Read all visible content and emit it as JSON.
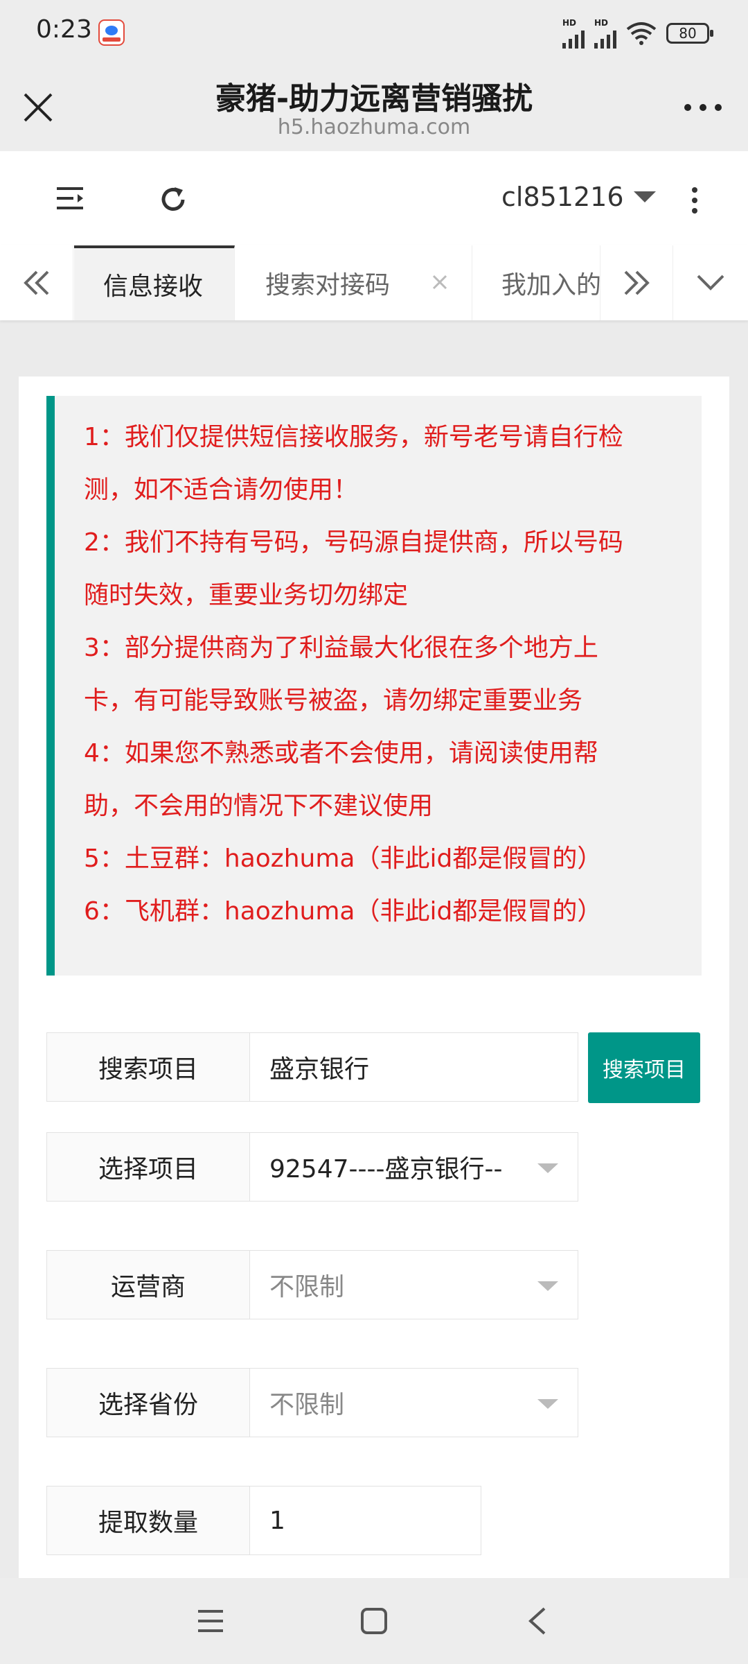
{
  "status_bar": {
    "time": "0:23",
    "hd1": "HD",
    "hd2": "HD",
    "battery": "80"
  },
  "title_bar": {
    "title": "豪猪-助力远离营销骚扰",
    "url": "h5.haozhuma.com"
  },
  "header": {
    "username": "cl851216"
  },
  "tabs": [
    {
      "label": "信息接收",
      "active": true
    },
    {
      "label": "搜索对接码",
      "closable": true
    },
    {
      "label": "我加入的"
    }
  ],
  "notice": [
    "1：我们仅提供短信接收服务，新号老号请自行检",
    "测，如不适合请勿使用！",
    "2：我们不持有号码，号码源自提供商，所以号码",
    "随时失效，重要业务切勿绑定",
    "3：部分提供商为了利益最大化很在多个地方上",
    "卡，有可能导致账号被盗，请勿绑定重要业务",
    "4：如果您不熟悉或者不会使用，请阅读使用帮",
    "助，不会用的情况下不建议使用",
    "5：土豆群：haozhuma（非此id都是假冒的）",
    "6：飞机群：haozhuma（非此id都是假冒的）"
  ],
  "form": {
    "search_label": "搜索项目",
    "search_value": "盛京银行",
    "search_button": "搜索项目",
    "project_label": "选择项目",
    "project_value": "92547----盛京银行--",
    "carrier_label": "运营商",
    "carrier_value": "不限制",
    "province_label": "选择省份",
    "province_value": "不限制",
    "quantity_label": "提取数量",
    "quantity_value": "1"
  },
  "colors": {
    "accent": "#009688",
    "notice_text": "#e01d1d"
  },
  "icons": [
    "close-icon",
    "more-icon",
    "menu-icon",
    "refresh-icon",
    "caret-down-icon",
    "kebab-icon",
    "double-left-icon",
    "double-right-icon",
    "chevron-down-icon",
    "recent-apps-icon",
    "home-icon",
    "back-icon"
  ]
}
